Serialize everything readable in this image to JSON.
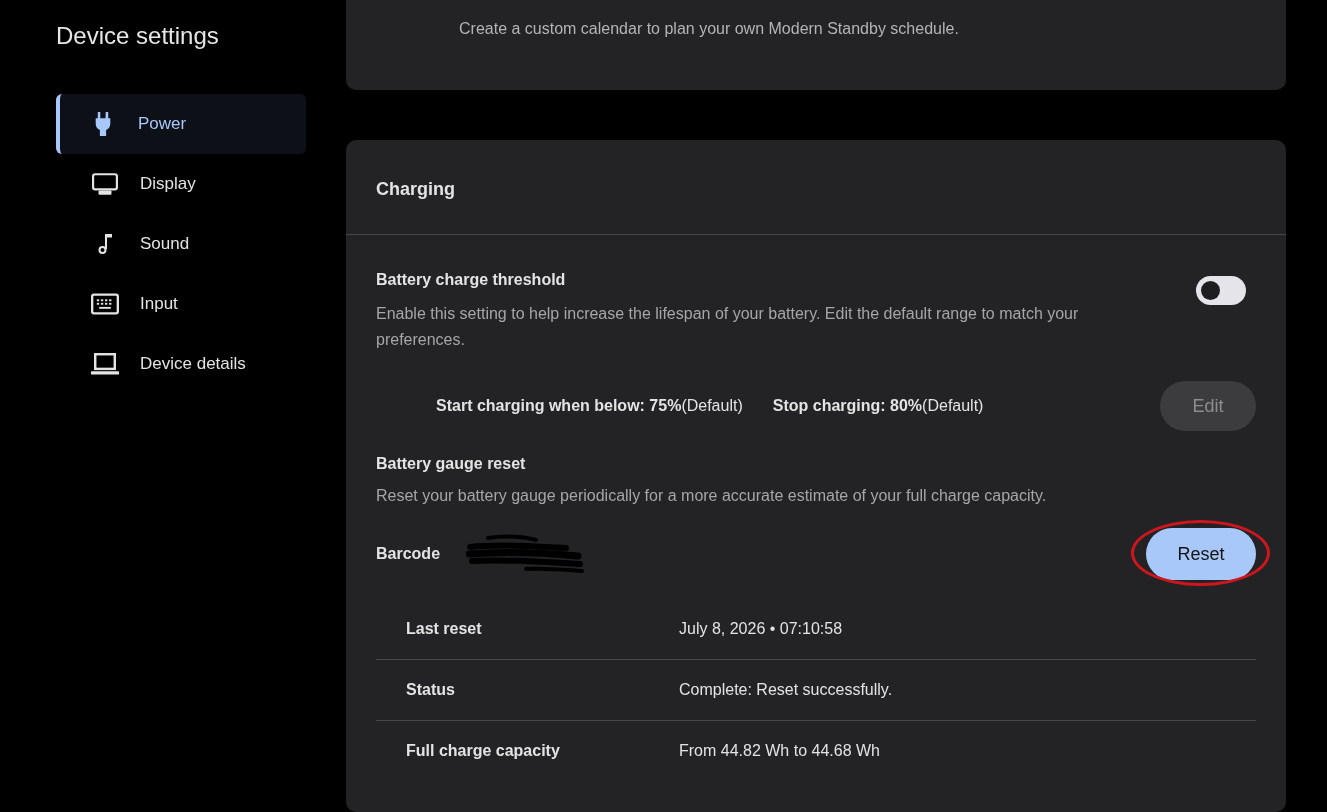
{
  "sidebar": {
    "title": "Device settings",
    "items": [
      {
        "label": "Power",
        "selected": true
      },
      {
        "label": "Display",
        "selected": false
      },
      {
        "label": "Sound",
        "selected": false
      },
      {
        "label": "Input",
        "selected": false
      },
      {
        "label": "Device details",
        "selected": false
      }
    ]
  },
  "standby_card": {
    "description": "Create a custom calendar to plan your own Modern Standby schedule."
  },
  "charging": {
    "title": "Charging",
    "threshold": {
      "title": "Battery charge threshold",
      "description": "Enable this setting to help increase the lifespan of your battery. Edit the default range to match your preferences.",
      "on": false,
      "range": [
        "**Start charging when below: 75%**(Default)",
        "**Stop charging: 80%**(Default)"
      ],
      "edit_button": {
        "label": "Edit",
        "disabled": true
      }
    },
    "gauge_reset": {
      "title": "Battery gauge reset",
      "description": "Reset your battery gauge periodically for a more accurate estimate of your full charge capacity.",
      "barcode": {
        "label": "Barcode",
        "redacted": true
      },
      "reset_button": {
        "label": "Reset",
        "circled": true
      },
      "details": [
        {
          "label": "Last reset",
          "value": "July 8, 2026 • 07:10:58"
        },
        {
          "label": "Status",
          "value": "Complete: Reset successfully."
        },
        {
          "label": "Full charge capacity",
          "value": "From 44.82 Wh to 44.68 Wh"
        }
      ]
    }
  }
}
